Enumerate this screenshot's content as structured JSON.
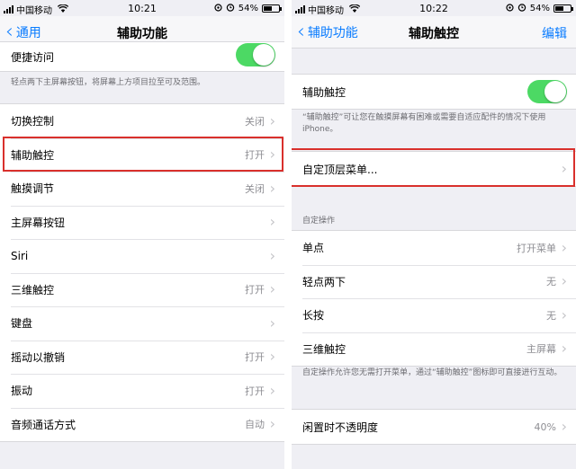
{
  "left": {
    "status": {
      "carrier": "中国移动",
      "time": "10:21",
      "battery": "54%",
      "battery_level": 0.54
    },
    "nav": {
      "back": "通用",
      "title": "辅助功能"
    },
    "top_row": {
      "label": "便捷访问",
      "toggle_on": true
    },
    "top_footnote": "轻点两下主屏幕按钮，将屏幕上方项目拉至可及范围。",
    "rows": [
      {
        "label": "切换控制",
        "value": "关闭"
      },
      {
        "label": "辅助触控",
        "value": "打开"
      },
      {
        "label": "触摸调节",
        "value": "关闭"
      },
      {
        "label": "主屏幕按钮",
        "value": ""
      },
      {
        "label": "Siri",
        "value": ""
      },
      {
        "label": "三维触控",
        "value": "打开"
      },
      {
        "label": "键盘",
        "value": ""
      },
      {
        "label": "摇动以撤销",
        "value": "打开"
      },
      {
        "label": "振动",
        "value": "打开"
      },
      {
        "label": "音频通话方式",
        "value": "自动"
      }
    ]
  },
  "right": {
    "status": {
      "carrier": "中国移动",
      "time": "10:22",
      "battery": "54%",
      "battery_level": 0.54
    },
    "nav": {
      "back": "辅助功能",
      "title": "辅助触控",
      "action": "编辑"
    },
    "assistive_touch": {
      "label": "辅助触控",
      "toggle_on": true
    },
    "assistive_footnote": "“辅助触控”可让您在触摸屏幕有困难或需要自适应配件的情况下使用 iPhone。",
    "custom_menu": {
      "label": "自定顶层菜单..."
    },
    "custom_actions_header": "自定操作",
    "custom_actions": [
      {
        "label": "单点",
        "value": "打开菜单"
      },
      {
        "label": "轻点两下",
        "value": "无"
      },
      {
        "label": "长按",
        "value": "无"
      },
      {
        "label": "三维触控",
        "value": "主屏幕"
      }
    ],
    "actions_footnote": "自定操作允许您无需打开菜单，通过“辅助触控”图标即可直接进行互动。",
    "idle_opacity": {
      "label": "闲置时不透明度",
      "value": "40%"
    }
  },
  "colors": {
    "accent": "#0a7cff",
    "toggle_on": "#4cd964",
    "highlight": "#d9302c",
    "background": "#efeff4"
  },
  "icons": {
    "back": "chevron-left-icon",
    "disclosure": "chevron-right-icon",
    "wifi": "wifi-icon",
    "alarm": "alarm-icon",
    "battery": "battery-icon"
  }
}
